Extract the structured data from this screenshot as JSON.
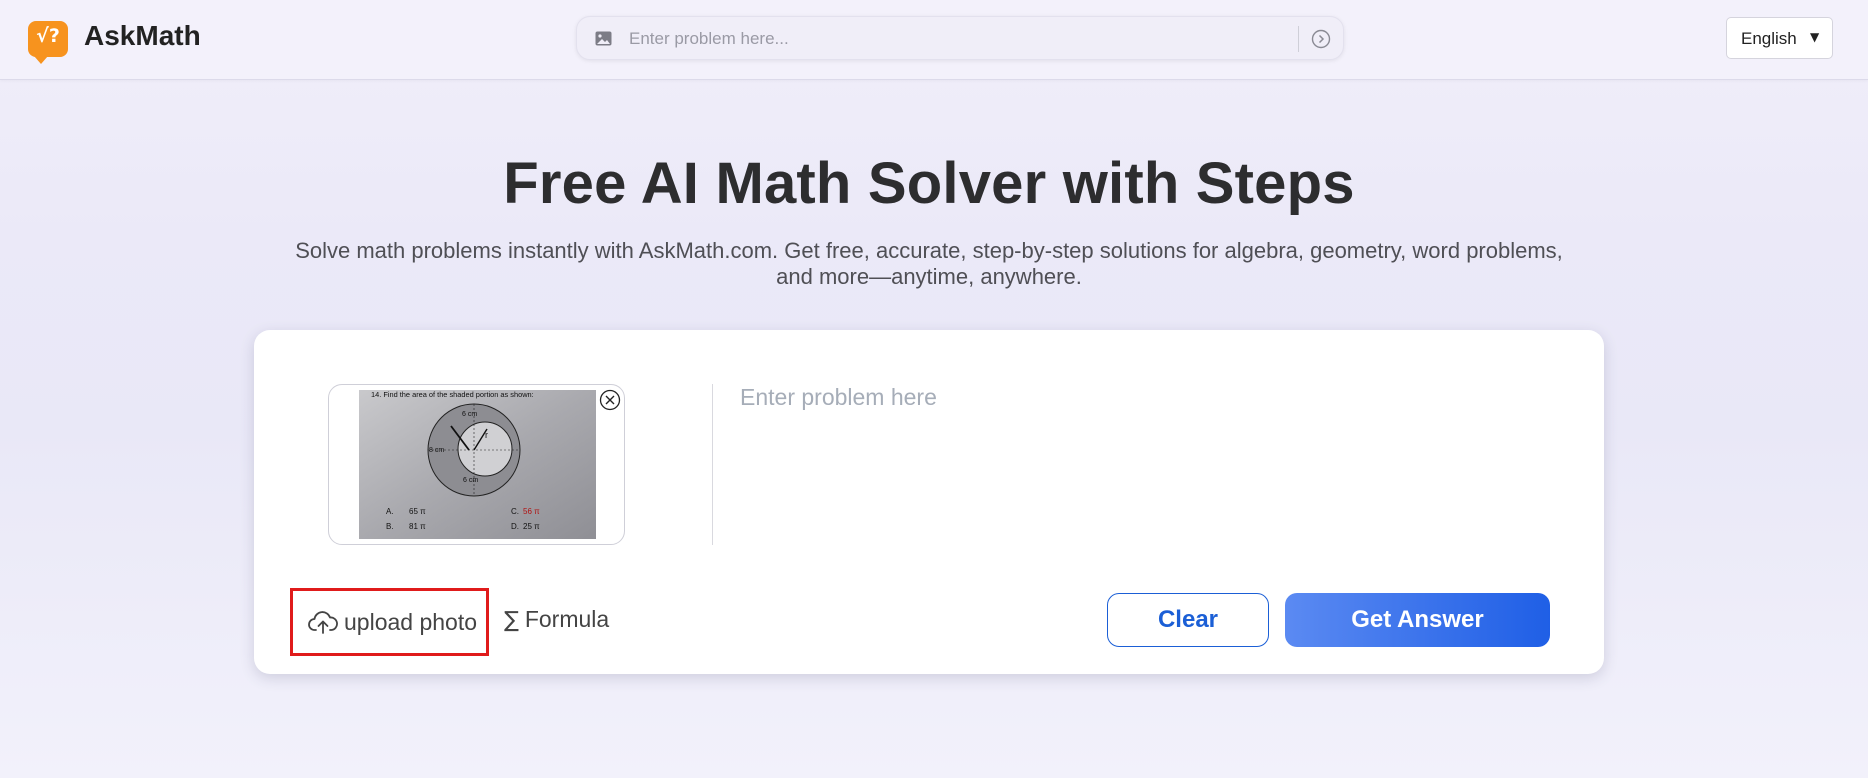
{
  "header": {
    "logo_icon": "sqrt-question-icon",
    "logo_glyph": "√?",
    "brand": "AskMath",
    "search": {
      "image_icon": "image-icon",
      "placeholder": "Enter problem here...",
      "submit_icon": "arrow-right-circle-icon"
    },
    "language": {
      "label": "English",
      "caret": "▼"
    }
  },
  "hero": {
    "title": "Free AI Math Solver with Steps",
    "subtitle_line1": "Solve math problems instantly with AskMath.com. Get free, accurate, step-by-step solutions for algebra, geometry, word problems,",
    "subtitle_line2": "and more—anytime, anywhere."
  },
  "solver": {
    "uploaded_image": {
      "heading": "14.  Find the area of the shaded portion as shown:",
      "label_top": "6 cm",
      "label_left": "8 cm",
      "label_bottom": "6 cm",
      "label_r": "r",
      "choice_a_letter": "A.",
      "choice_a_value": "65 π",
      "choice_b_letter": "B.",
      "choice_b_value": "81 π",
      "choice_c_letter": "C.",
      "choice_c_value": "56 π",
      "choice_d_letter": "D.",
      "choice_d_value": "25 π",
      "close_icon": "close-circle-icon"
    },
    "problem_placeholder": "Enter problem here",
    "upload_label": "upload photo",
    "upload_icon": "cloud-upload-icon",
    "formula_label": "Formula",
    "formula_icon": "sigma-icon",
    "formula_glyph": "∑",
    "clear_label": "Clear",
    "answer_label": "Get Answer",
    "colors": {
      "primary": "#1b5fd6",
      "highlight": "#e01b1b",
      "brand": "#f7931e"
    }
  }
}
